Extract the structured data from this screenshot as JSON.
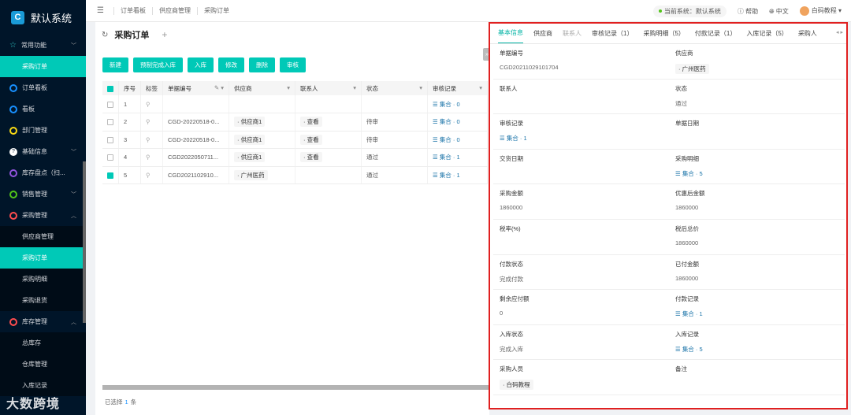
{
  "app": {
    "name": "默认系统"
  },
  "sidebar": {
    "items": [
      {
        "label": "常用功能",
        "icon": "star-icon",
        "type": "group"
      },
      {
        "label": "采购订单",
        "type": "sub",
        "active": true
      },
      {
        "label": "订单看板",
        "icon": "circle-icon"
      },
      {
        "label": "看板",
        "icon": "circle-icon"
      },
      {
        "label": "部门管理",
        "icon": "circle-icon"
      },
      {
        "label": "基础信息",
        "icon": "question-icon",
        "type": "group"
      },
      {
        "label": "库存盘点（扫...",
        "icon": "circle-icon"
      },
      {
        "label": "销售管理",
        "icon": "circle-icon",
        "type": "group"
      },
      {
        "label": "采购管理",
        "icon": "circle-icon",
        "type": "group-open"
      },
      {
        "label": "供应商管理",
        "type": "sub"
      },
      {
        "label": "采购订单",
        "type": "sub",
        "active": true
      },
      {
        "label": "采购明细",
        "type": "sub"
      },
      {
        "label": "采购退货",
        "type": "sub"
      },
      {
        "label": "库存管理",
        "icon": "circle-icon",
        "type": "group-open"
      },
      {
        "label": "总库存",
        "type": "sub"
      },
      {
        "label": "仓库管理",
        "type": "sub"
      },
      {
        "label": "入库记录",
        "type": "sub"
      }
    ],
    "watermark": "大数跨境"
  },
  "header": {
    "breadcrumbs": [
      "订单看板",
      "供应商管理",
      "采购订单"
    ],
    "current_system": "当前系统：默认系统",
    "help": "帮助",
    "language": "中文",
    "user": "白码教程"
  },
  "page": {
    "title": "采购订单",
    "toolbar": [
      "新建",
      "预制完成入库",
      "入库",
      "修改",
      "删除",
      "审核"
    ]
  },
  "table": {
    "columns": [
      "序号",
      "标签",
      "单据编号",
      "供应商",
      "联系人",
      "状态",
      "审核记录"
    ],
    "rows": [
      {
        "no": "1",
        "code": "",
        "supplier": "",
        "contact": "",
        "status": "",
        "audit": "集合 · 0",
        "checked": false
      },
      {
        "no": "2",
        "code": "CGD-20220518-0...",
        "supplier": "· 供应商1",
        "contact": "· 查看",
        "status": "待审",
        "audit": "集合 · 0",
        "checked": false
      },
      {
        "no": "3",
        "code": "CGD-20220518-0...",
        "supplier": "· 供应商1",
        "contact": "· 查看",
        "status": "待审",
        "audit": "集合 · 0",
        "checked": false
      },
      {
        "no": "4",
        "code": "CGD2022050711...",
        "supplier": "· 供应商1",
        "contact": "· 查看",
        "status": "通过",
        "audit": "集合 · 1",
        "checked": false
      },
      {
        "no": "5",
        "code": "CGD2021102910...",
        "supplier": "· 广州医药",
        "contact": "",
        "status": "通过",
        "audit": "集合 · 1",
        "checked": true
      }
    ]
  },
  "footer": {
    "prefix": "已选择",
    "count": "1",
    "suffix": "条"
  },
  "detail": {
    "tabs": [
      "基本信息",
      "供应商",
      "联系人",
      "审核记录（1）",
      "采购明细（5）",
      "付款记录（1）",
      "入库记录（5）",
      "采购人"
    ],
    "fields": [
      {
        "label": "单据编号",
        "value": "CGD20211029101704"
      },
      {
        "label": "供应商",
        "value": "· 广州医药",
        "tag": true
      },
      {
        "label": "联系人",
        "value": ""
      },
      {
        "label": "状态",
        "value": "通过"
      },
      {
        "label": "审核记录",
        "value": "集合 · 1",
        "collection": true
      },
      {
        "label": "单据日期",
        "value": ""
      },
      {
        "label": "交货日期",
        "value": ""
      },
      {
        "label": "采购明细",
        "value": "集合 · 5",
        "collection": true
      },
      {
        "label": "采购金额",
        "value": "1860000"
      },
      {
        "label": "优惠后金额",
        "value": "1860000"
      },
      {
        "label": "税率(%)",
        "value": ""
      },
      {
        "label": "税后总价",
        "value": "1860000"
      },
      {
        "label": "付款状态",
        "value": "完成付款"
      },
      {
        "label": "已付金额",
        "value": "1860000"
      },
      {
        "label": "剩余应付额",
        "value": "0"
      },
      {
        "label": "付款记录",
        "value": "集合 · 1",
        "collection": true
      },
      {
        "label": "入库状态",
        "value": "完成入库"
      },
      {
        "label": "入库记录",
        "value": "集合 · 5",
        "collection": true
      },
      {
        "label": "采购人员",
        "value": "· 白码教程",
        "tag": true
      },
      {
        "label": "备注",
        "value": ""
      }
    ]
  },
  "colors": {
    "accent": "#00c9b7",
    "sidebar_bg": "#001529",
    "highlight_border": "#e02020"
  }
}
